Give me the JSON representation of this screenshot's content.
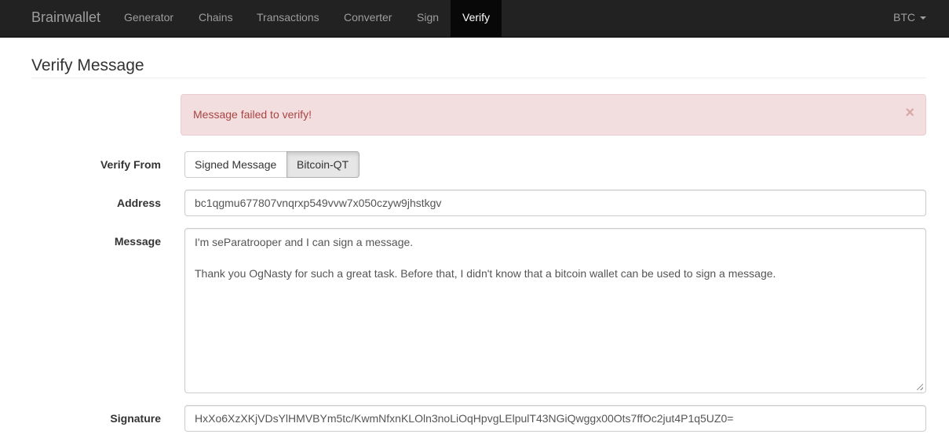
{
  "navbar": {
    "brand": "Brainwallet",
    "items": [
      {
        "label": "Generator"
      },
      {
        "label": "Chains"
      },
      {
        "label": "Transactions"
      },
      {
        "label": "Converter"
      },
      {
        "label": "Sign"
      },
      {
        "label": "Verify"
      }
    ],
    "active": "Verify",
    "currency": "BTC"
  },
  "page": {
    "title": "Verify Message"
  },
  "alert": {
    "text": "Message failed to verify!",
    "close": "×"
  },
  "form": {
    "verify_from": {
      "label": "Verify From",
      "options": [
        "Signed Message",
        "Bitcoin-QT"
      ],
      "selected": "Bitcoin-QT"
    },
    "address": {
      "label": "Address",
      "value": "bc1qgmu677807vnqrxp549vvw7x050czyw9jhstkgv"
    },
    "message": {
      "label": "Message",
      "line1": "I'm seParatrooper and I can sign a message.",
      "line2": "Thank you OgNasty for such a great task. Before that, I didn't know that a bitcoin wallet can be used to sign a message."
    },
    "signature": {
      "label": "Signature",
      "value": "HxXo6XzXKjVDsYlHMVBYm5tc/KwmNfxnKLOln3noLiOqHpvgLElpulT43NGiQwggx00Ots7ffOc2jut4P1q5UZ0="
    }
  },
  "colors": {
    "navbar_bg": "#222222",
    "nav_active_bg": "#080808",
    "alert_bg": "#f2dede",
    "alert_text": "#a94442"
  }
}
